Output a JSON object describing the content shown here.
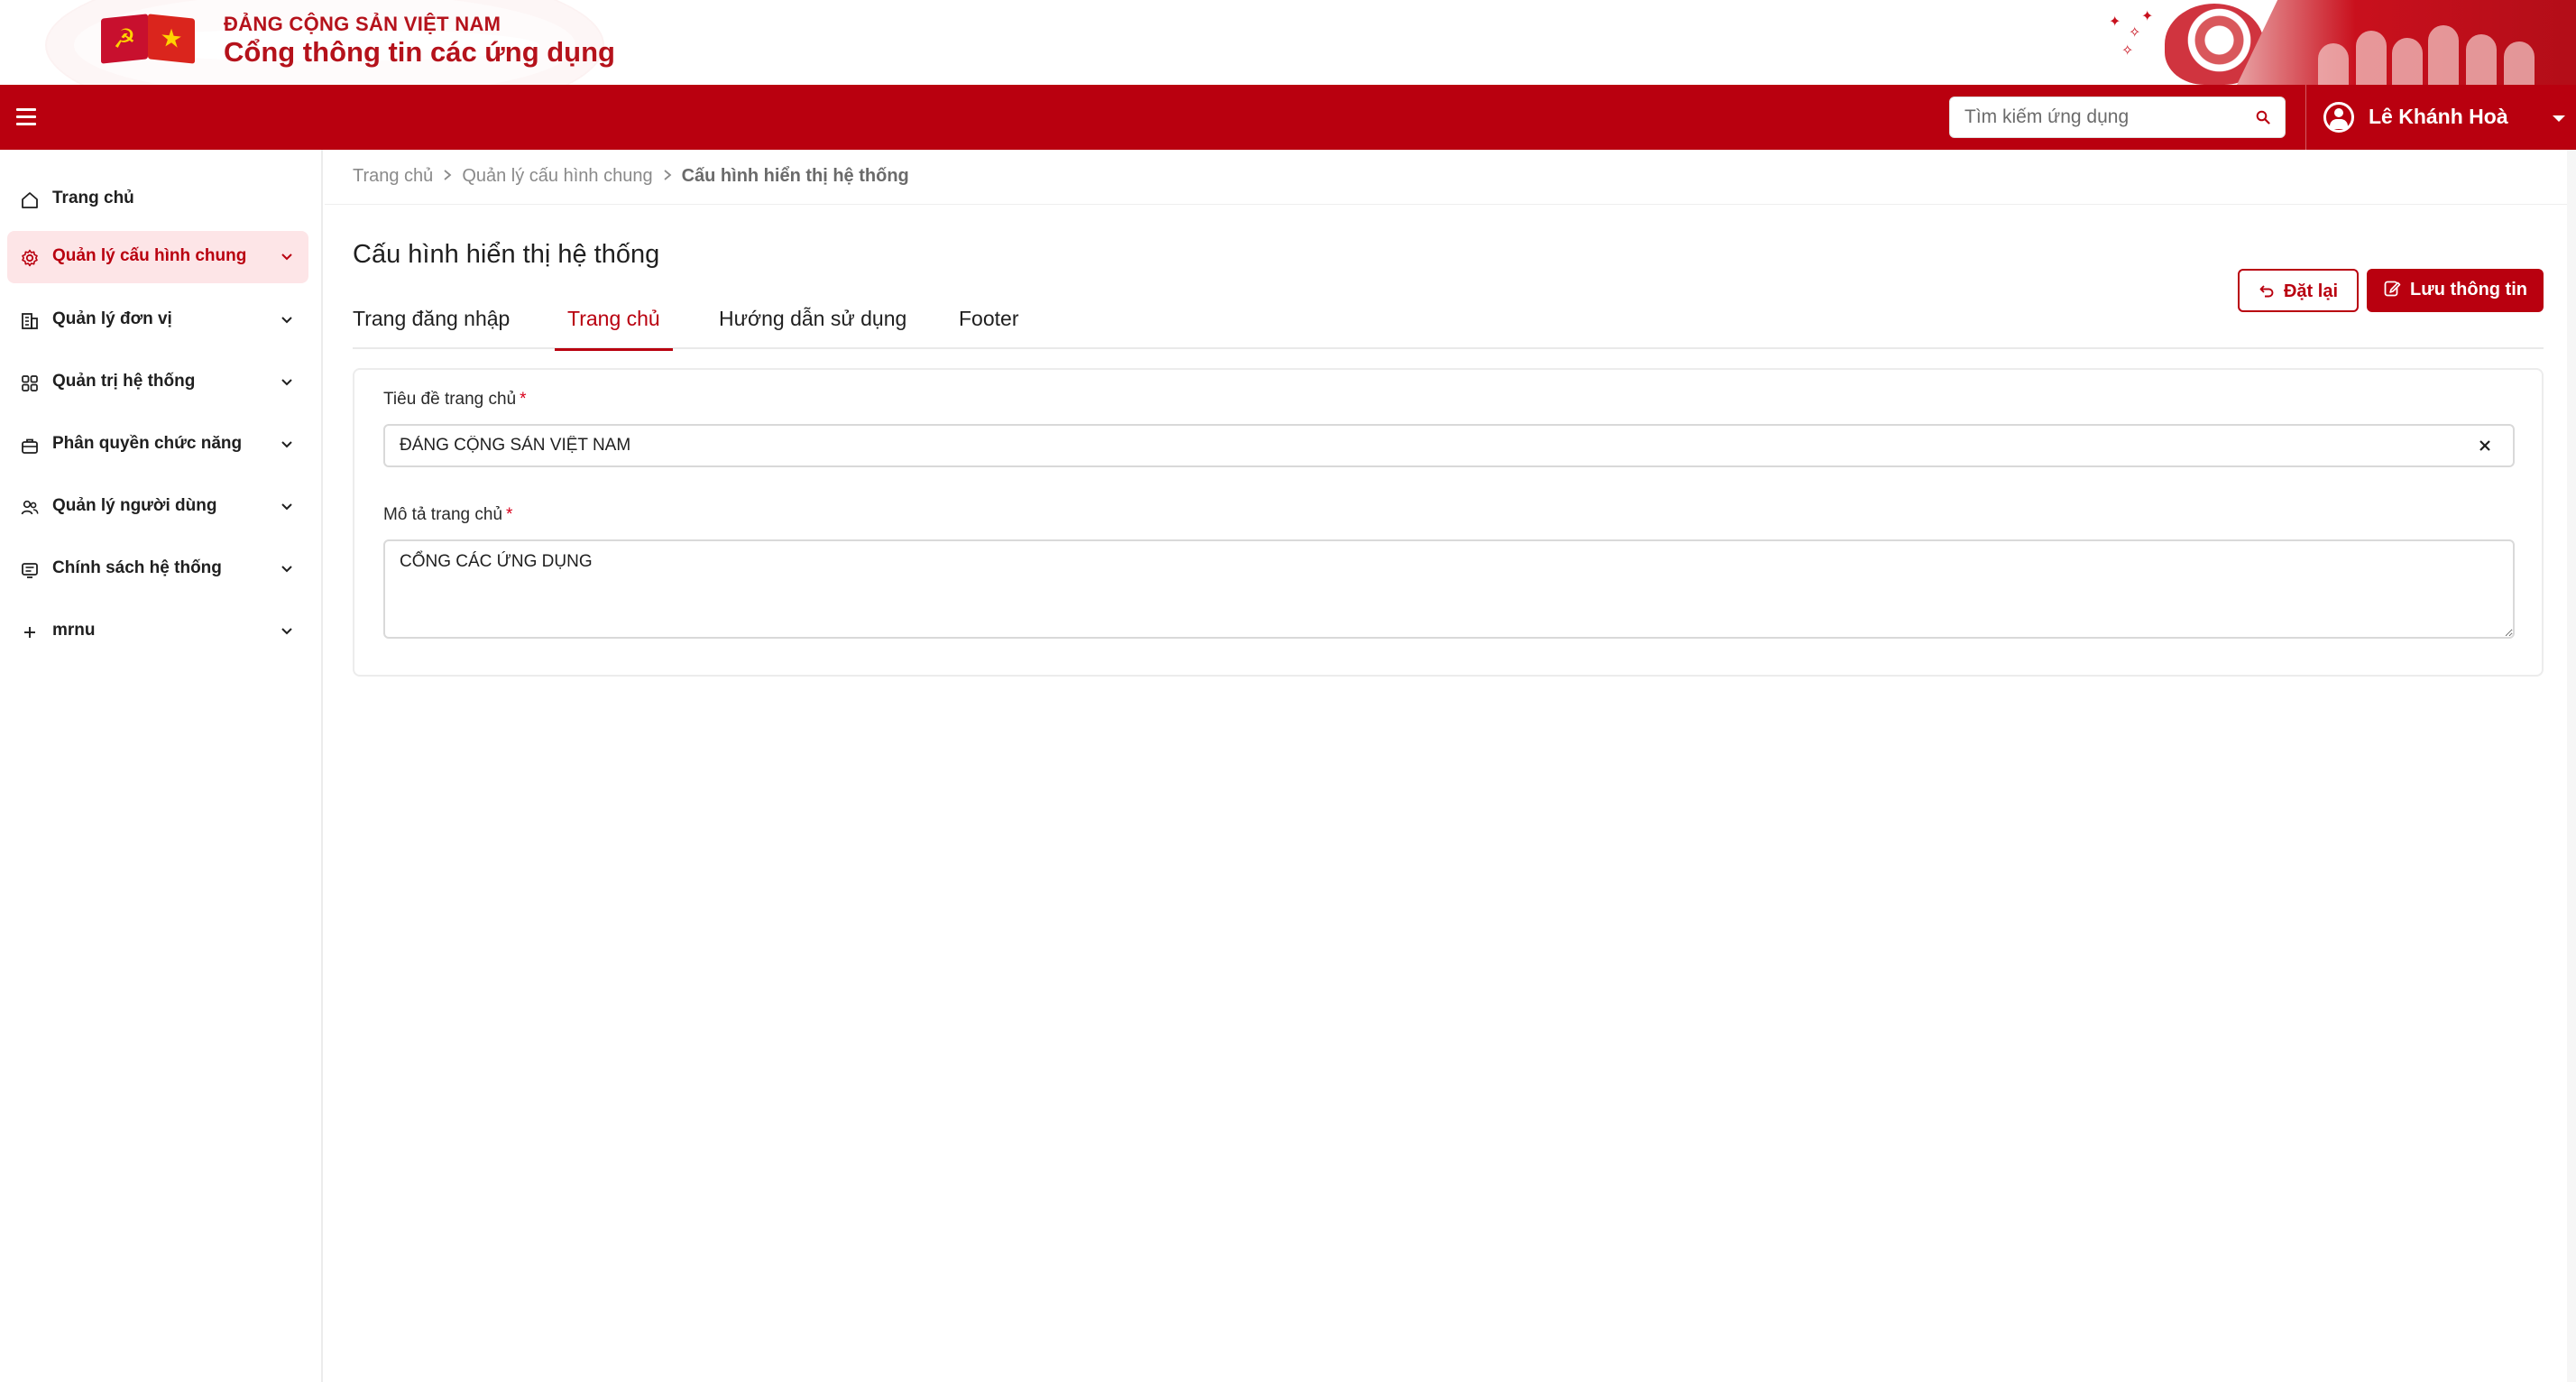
{
  "brand": {
    "line1": "ĐẢNG CỘNG SẢN VIỆT NAM",
    "line2": "Cổng thông tin các ứng dụng"
  },
  "colors": {
    "primary": "#b9000f",
    "primary_light": "#fde5e7",
    "text": "#1f1f1f",
    "muted": "#8a8a8a"
  },
  "header": {
    "search_placeholder": "Tìm kiếm ứng dụng",
    "user_name": "Lê Khánh Hoà"
  },
  "sidebar": {
    "items": [
      {
        "label": "Trang chủ",
        "icon": "home-icon",
        "active": false,
        "expandable": false
      },
      {
        "label": "Quản lý cấu hình chung",
        "icon": "gear-icon",
        "active": true,
        "expandable": true
      },
      {
        "label": "Quản lý đơn vị",
        "icon": "building-icon",
        "active": false,
        "expandable": true
      },
      {
        "label": "Quản trị hệ thống",
        "icon": "grid-icon",
        "active": false,
        "expandable": true
      },
      {
        "label": "Phân quyền chức năng",
        "icon": "briefcase-icon",
        "active": false,
        "expandable": true
      },
      {
        "label": "Quản lý người dùng",
        "icon": "users-icon",
        "active": false,
        "expandable": true
      },
      {
        "label": "Chính sách hệ thống",
        "icon": "policy-icon",
        "active": false,
        "expandable": true
      },
      {
        "label": "mrnu",
        "icon": "plus-icon",
        "active": false,
        "expandable": true
      }
    ]
  },
  "breadcrumb": {
    "items": [
      "Trang chủ",
      "Quản lý cấu hình chung"
    ],
    "current": "Cấu hình hiển thị hệ thống"
  },
  "page": {
    "title": "Cấu hình hiển thị hệ thống",
    "reset_label": "Đặt lại",
    "save_label": "Lưu thông tin"
  },
  "tabs": {
    "items": [
      "Trang đăng nhập",
      "Trang chủ",
      "Hướng dẫn sử dụng",
      "Footer"
    ],
    "active": "Trang chủ"
  },
  "form": {
    "title_label": "Tiêu đề trang chủ",
    "title_value": "ĐẢNG CỘNG SẢN VIỆT NAM",
    "desc_label": "Mô tả trang chủ",
    "desc_value": "CỔNG CÁC ỨNG DỤNG",
    "required_mark": "*"
  }
}
